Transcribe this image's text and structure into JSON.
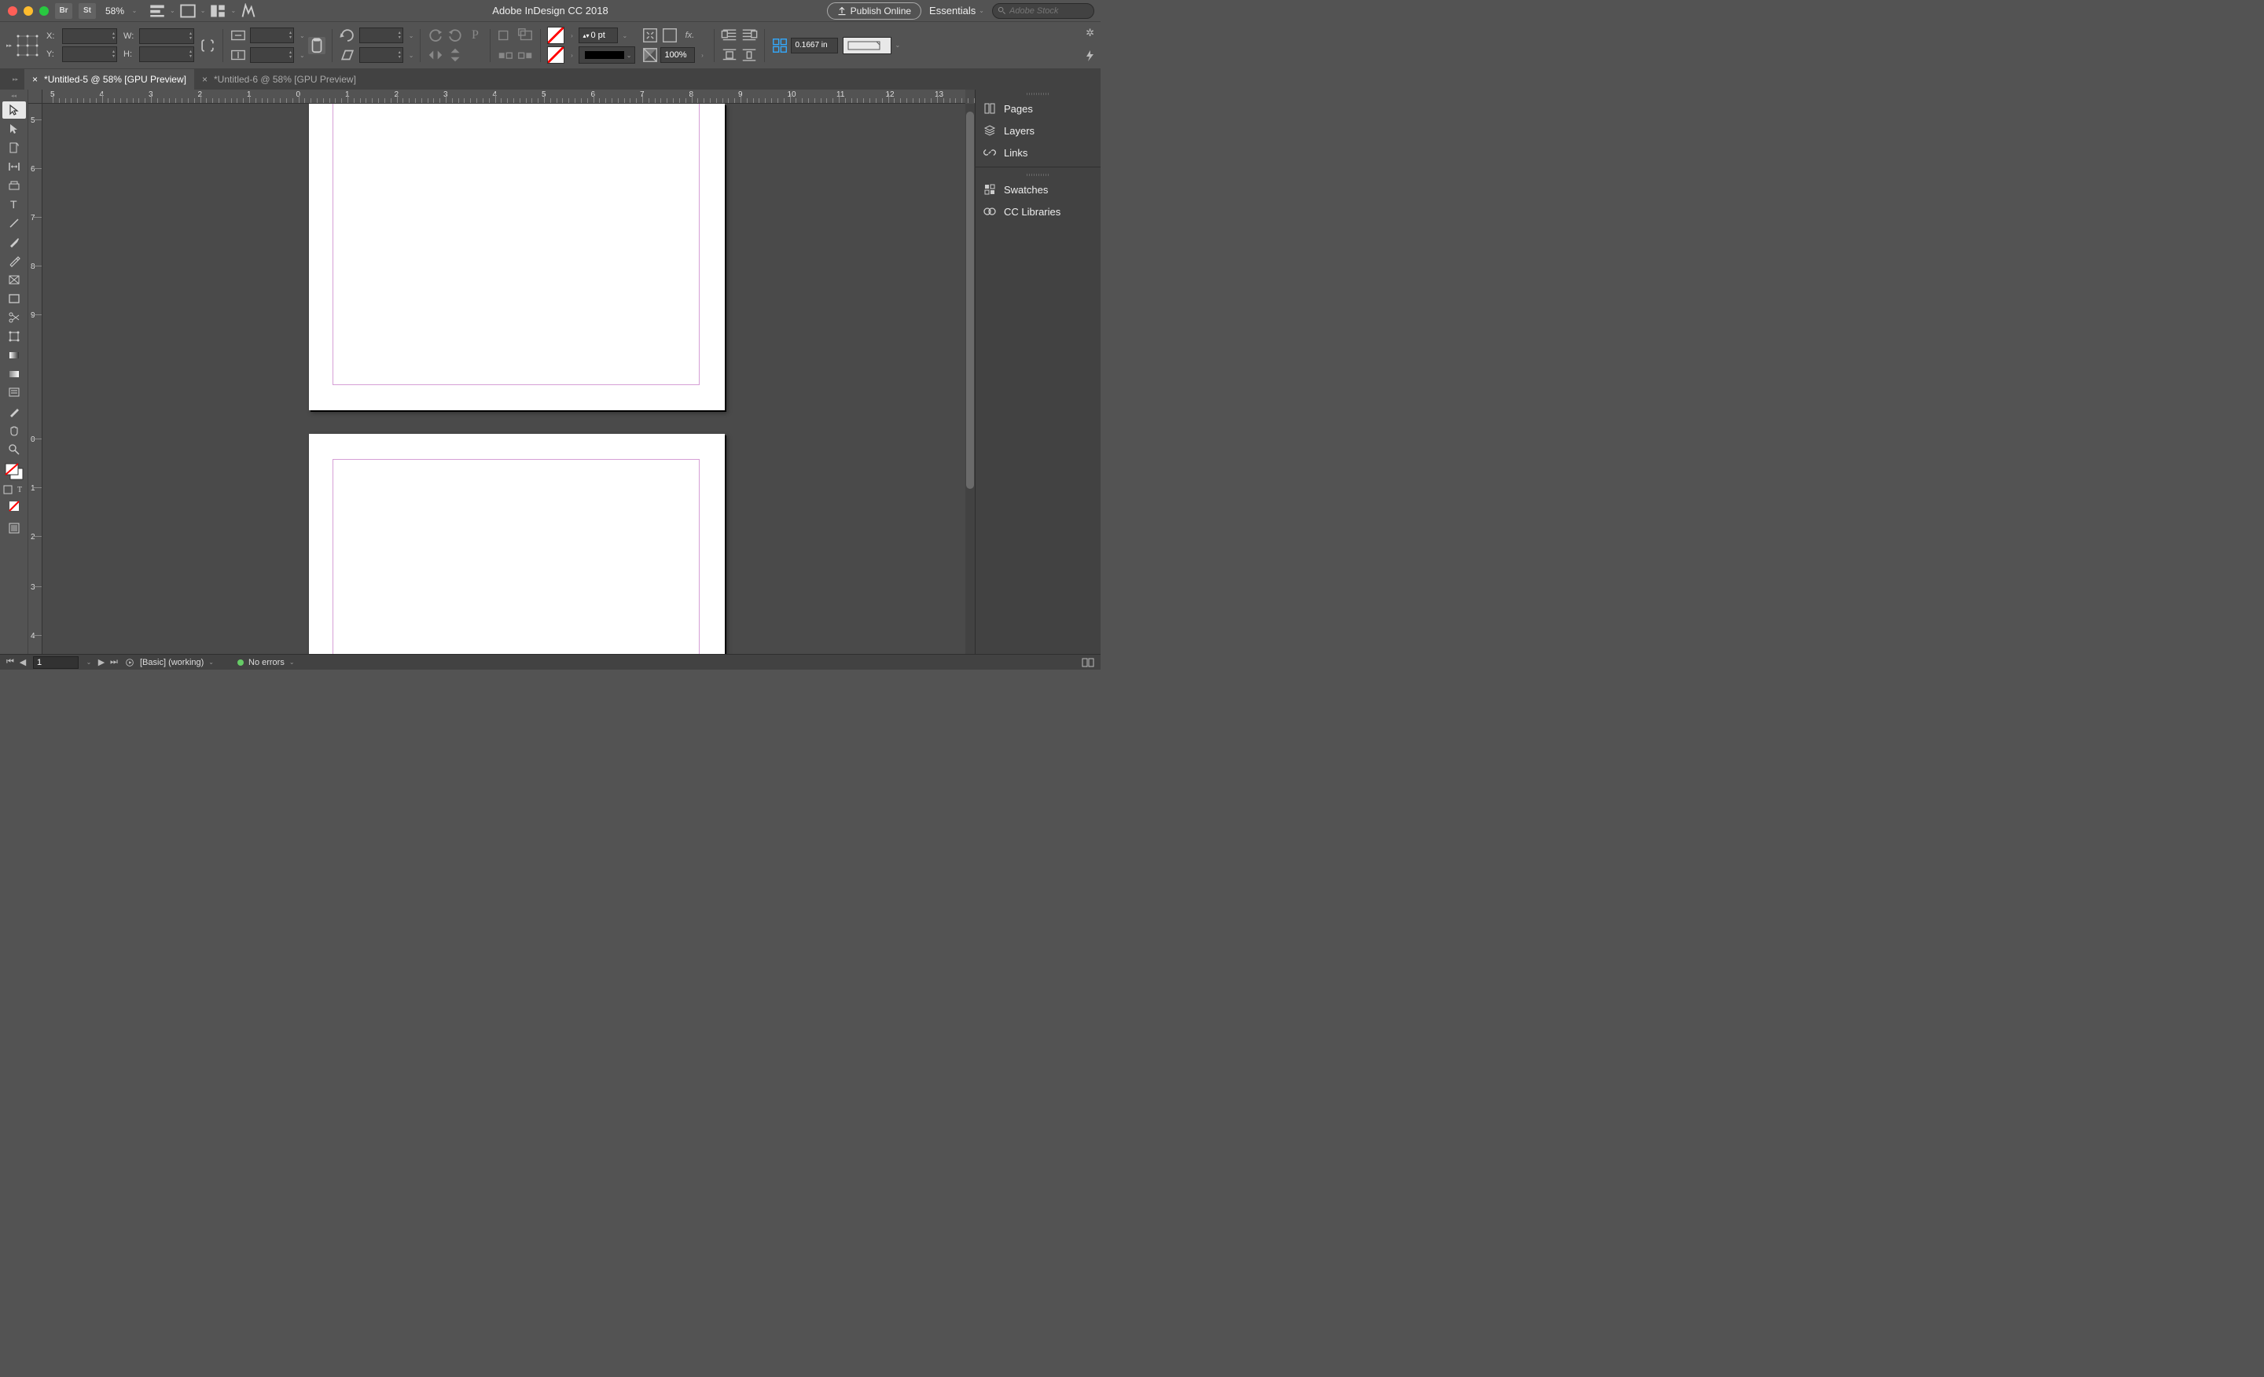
{
  "app": {
    "title": "Adobe InDesign CC 2018"
  },
  "titlebar": {
    "bridge": "Br",
    "stock": "St",
    "zoom": "58%",
    "publish": "Publish Online",
    "workspace": "Essentials",
    "search_placeholder": "Adobe Stock"
  },
  "control": {
    "x_label": "X:",
    "y_label": "Y:",
    "w_label": "W:",
    "h_label": "H:",
    "stroke_value": "0 pt",
    "opacity": "100%",
    "grid_val": "0.1667 in"
  },
  "tabs": [
    {
      "label": "*Untitled-5 @ 58% [GPU Preview]",
      "active": true
    },
    {
      "label": "*Untitled-6 @ 58% [GPU Preview]",
      "active": false
    }
  ],
  "rulers": {
    "h": [
      "5",
      "4",
      "3",
      "2",
      "1",
      "0",
      "1",
      "2",
      "3",
      "4",
      "5",
      "6",
      "7",
      "8",
      "9",
      "10",
      "11",
      "12",
      "13"
    ],
    "v": [
      "5",
      "6",
      "7",
      "8",
      "9",
      "0",
      "1",
      "2",
      "3",
      "4"
    ]
  },
  "panels": [
    "Pages",
    "Layers",
    "Links",
    "Swatches",
    "CC Libraries"
  ],
  "status": {
    "page": "1",
    "preset": "[Basic] (working)",
    "errors": "No errors"
  }
}
